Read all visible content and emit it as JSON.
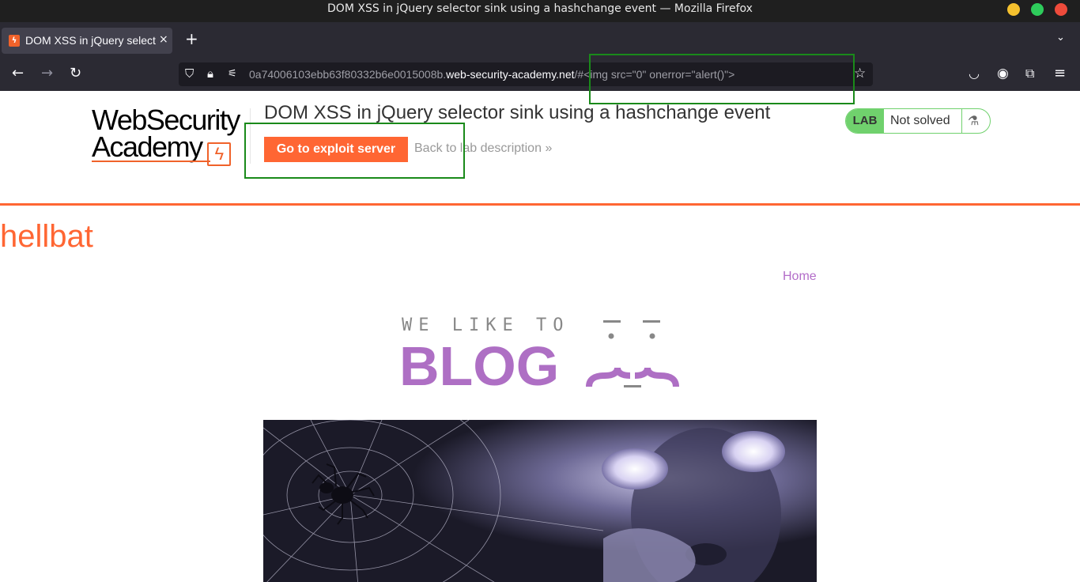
{
  "window": {
    "title": "DOM XSS in jQuery selector sink using a hashchange event — Mozilla Firefox"
  },
  "tab": {
    "title": "DOM XSS in jQuery selector sink using a hashchange event",
    "favicon": "lightning-bolt-icon",
    "close": "×",
    "new_tab": "+",
    "list": "⌄"
  },
  "urlbar": {
    "prefix": "0a74006103ebb63f80332b6e0015008b.",
    "host": "web-security-academy.net",
    "path": "/#<img src=\"0\" onerror=\"alert()\">"
  },
  "lab_header": {
    "logo_line1": "WebSecurity",
    "logo_line2": "Academy",
    "title": "DOM XSS in jQuery selector sink using a hashchange event",
    "exploit_button": "Go to exploit server",
    "back_link": "Back to lab description",
    "back_chevron": "»"
  },
  "lab_status": {
    "badge": "LAB",
    "status": "Not solved",
    "icon": "flask-icon"
  },
  "site": {
    "title": "hellbat",
    "nav_home": "Home"
  },
  "blog_logo": {
    "tagline": "WE LIKE TO",
    "word": "BLOG"
  },
  "colors": {
    "accent_orange": "#ff6633",
    "lab_green": "#70d16d",
    "blog_purple": "#ae6fc4",
    "annotation_green": "#1a8a1a"
  }
}
